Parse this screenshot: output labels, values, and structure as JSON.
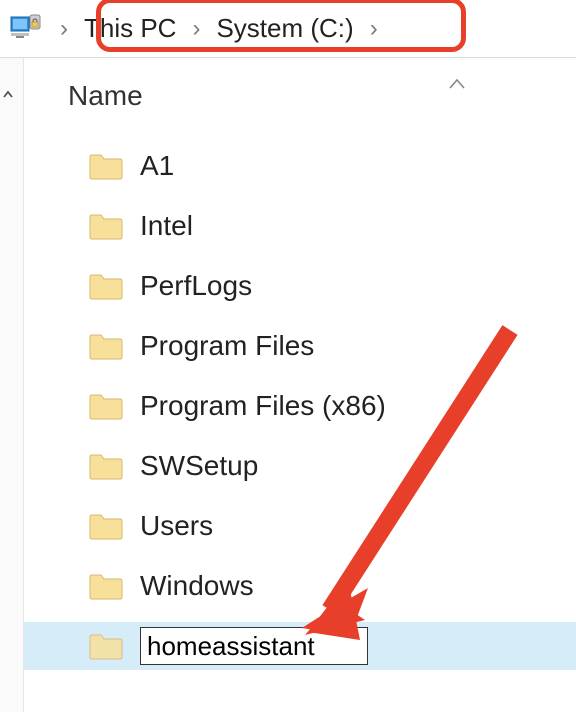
{
  "breadcrumb": {
    "items": [
      {
        "label": "This PC"
      },
      {
        "label": "System (C:)"
      }
    ]
  },
  "columns": {
    "name": "Name"
  },
  "folders": [
    {
      "label": "A1"
    },
    {
      "label": "Intel"
    },
    {
      "label": "PerfLogs"
    },
    {
      "label": "Program Files"
    },
    {
      "label": "Program Files (x86)"
    },
    {
      "label": "SWSetup"
    },
    {
      "label": "Users"
    },
    {
      "label": "Windows"
    }
  ],
  "rename": {
    "value": "homeassistant"
  },
  "annotation": {
    "highlight_color": "#e83f2a",
    "arrow_color": "#e83f2a"
  }
}
